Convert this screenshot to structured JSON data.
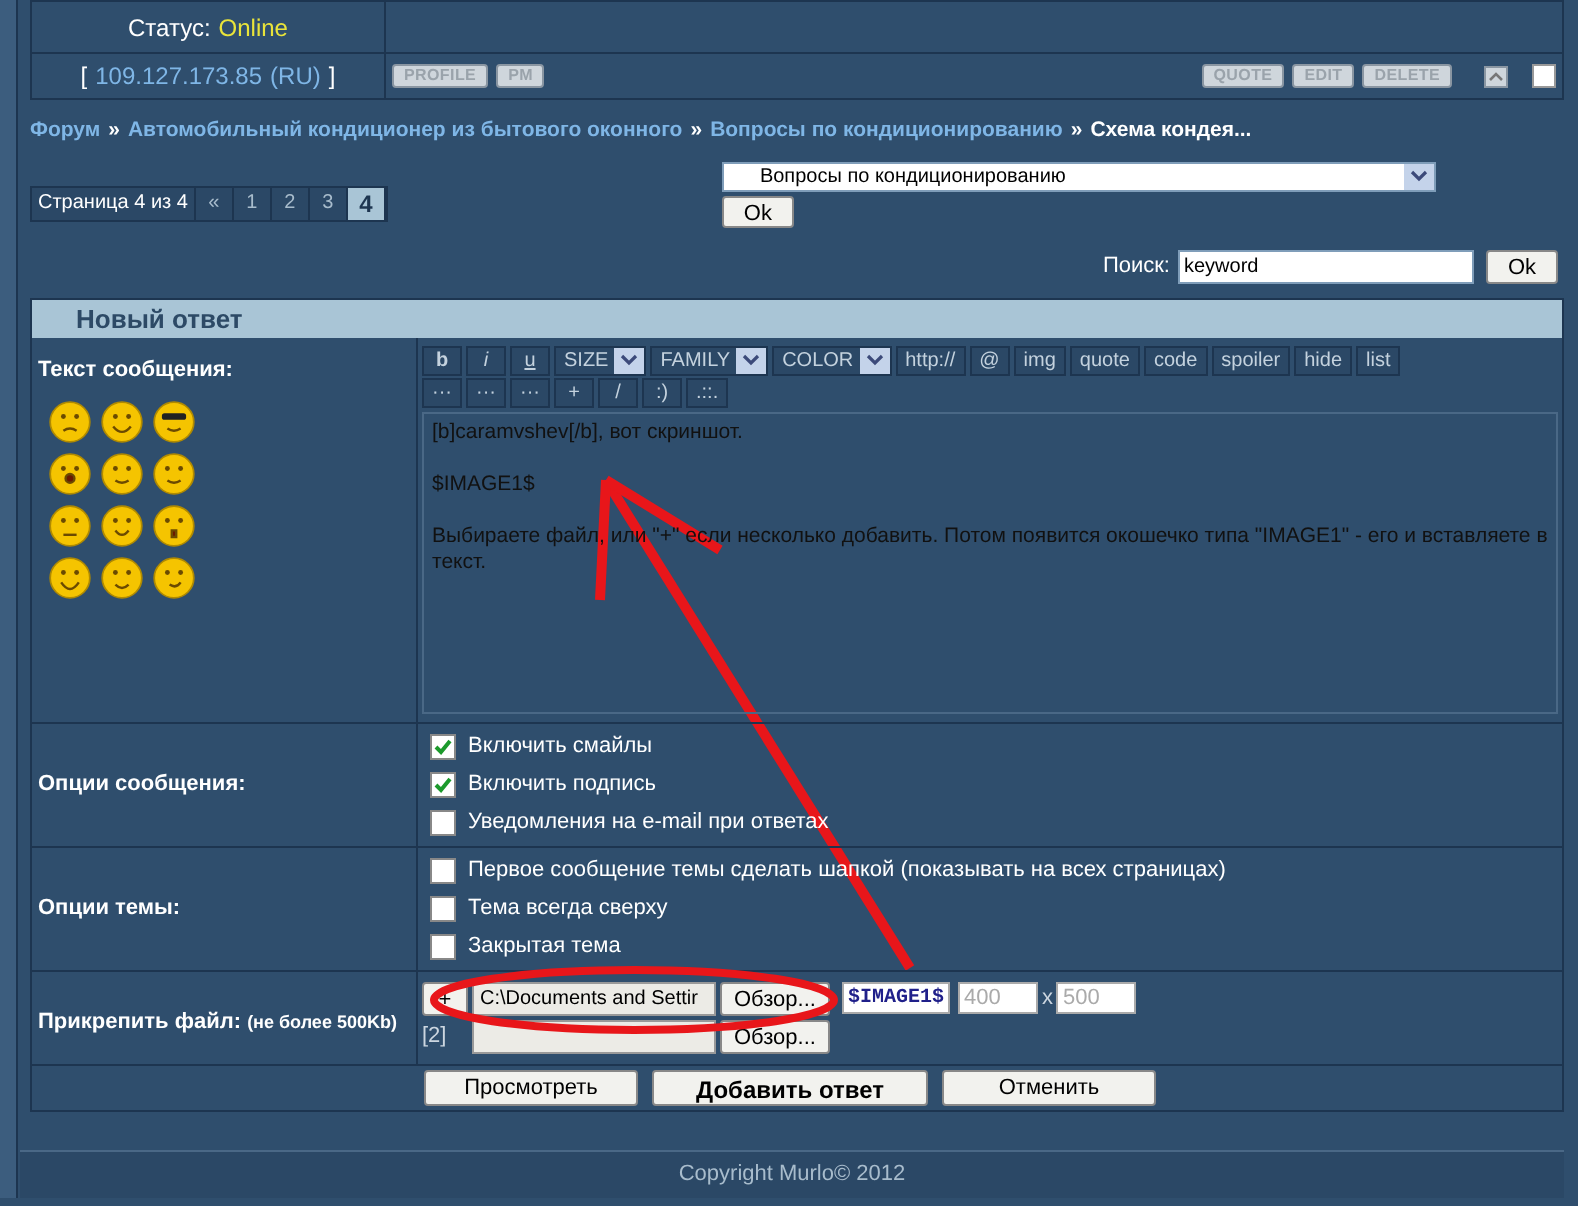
{
  "post": {
    "status_label": "Статус:",
    "status_value": "Online",
    "ip_line": {
      "open": "[",
      "ip": "109.127.173.85",
      "country_open": "(",
      "country": "RU",
      "country_close": ")",
      "close": "]"
    },
    "left_buttons": [
      "PROFILE",
      "PM"
    ],
    "right_buttons": [
      "QUOTE",
      "EDIT",
      "DELETE"
    ],
    "select_checked": false
  },
  "breadcrumb": [
    {
      "label": "Форум",
      "kind": "link"
    },
    {
      "label": "»",
      "kind": "sep"
    },
    {
      "label": "Автомобильный кондиционер из бытового оконного",
      "kind": "link"
    },
    {
      "label": "»",
      "kind": "sep"
    },
    {
      "label": "Вопросы по кондиционированию",
      "kind": "link"
    },
    {
      "label": "»",
      "kind": "sep"
    },
    {
      "label": "Схема кондея...",
      "kind": "current"
    }
  ],
  "pagination": {
    "label": "Страница 4 из 4",
    "pages": [
      {
        "label": "«",
        "selected": false
      },
      {
        "label": "1",
        "selected": false
      },
      {
        "label": "2",
        "selected": false
      },
      {
        "label": "3",
        "selected": false
      },
      {
        "label": "4",
        "selected": true
      }
    ]
  },
  "forum_select": {
    "value": "Вопросы по кондиционированию",
    "button": "Ok"
  },
  "search": {
    "label": "Поиск:",
    "value": "keyword",
    "button": "Ok"
  },
  "form": {
    "title": "Новый ответ",
    "message_label": "Текст сообщения:",
    "toolbar_rows": [
      [
        {
          "label": "b",
          "kind": "bold"
        },
        {
          "label": "i",
          "kind": "italic"
        },
        {
          "label": "u",
          "kind": "underline"
        },
        {
          "label": "SIZE",
          "kind": "dropdown"
        },
        {
          "label": "FAMILY",
          "kind": "dropdown"
        },
        {
          "label": "COLOR",
          "kind": "dropdown"
        },
        {
          "label": "http://",
          "kind": "button"
        },
        {
          "label": "@",
          "kind": "button"
        },
        {
          "label": "img",
          "kind": "button"
        },
        {
          "label": "quote",
          "kind": "button"
        },
        {
          "label": "code",
          "kind": "button"
        },
        {
          "label": "spoiler",
          "kind": "button"
        },
        {
          "label": "hide",
          "kind": "button"
        },
        {
          "label": "list",
          "kind": "button"
        }
      ],
      [
        {
          "label": "···",
          "kind": "button"
        },
        {
          "label": "···",
          "kind": "button"
        },
        {
          "label": "···",
          "kind": "button"
        },
        {
          "label": "+",
          "kind": "button"
        },
        {
          "label": "/",
          "kind": "button"
        },
        {
          "label": ":)",
          "kind": "button"
        },
        {
          "label": ".::.",
          "kind": "button"
        }
      ]
    ],
    "message": "[b]caramvshev[/b], вот скриншот.\n\n$IMAGE1$\n\nВыбираете файл, или \"+\" если несколько добавить. Потом появится окошечко типа \"IMAGE1\" - его и вставляете в текст.",
    "message_options": {
      "label": "Опции сообщения:",
      "items": [
        {
          "label": "Включить смайлы",
          "checked": true
        },
        {
          "label": "Включить подпись",
          "checked": true
        },
        {
          "label": "Уведомления на e-mail при ответах",
          "checked": false
        }
      ]
    },
    "topic_options": {
      "label": "Опции темы:",
      "items": [
        {
          "label": "Первое сообщение темы сделать шапкой (показывать на всех страницах)",
          "checked": false
        },
        {
          "label": "Тема всегда сверху",
          "checked": false
        },
        {
          "label": "Закрытая тема",
          "checked": false
        }
      ]
    },
    "attach": {
      "label": "Прикрепить файл:",
      "note": "(не более 500Kb)",
      "add_button": "+",
      "rows": [
        {
          "path": "C:\\Documents and Settir",
          "browse": "Обзор...",
          "tag": "$IMAGE1$",
          "width_placeholder": "400",
          "times": "x",
          "height_placeholder": "500"
        },
        {
          "index": "[2]",
          "browse": "Обзор..."
        }
      ]
    },
    "buttons": [
      {
        "label": "Просмотреть",
        "kind": "normal"
      },
      {
        "label": "Добавить ответ",
        "kind": "primary"
      },
      {
        "label": "Отменить",
        "kind": "normal"
      }
    ]
  },
  "footer": "Copyright Murlo© 2012"
}
